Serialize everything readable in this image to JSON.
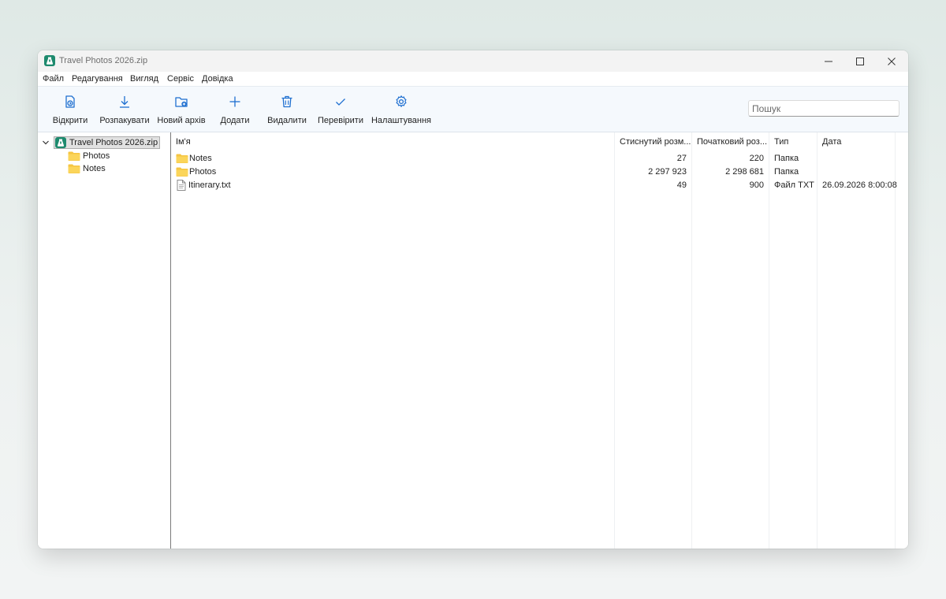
{
  "window": {
    "title": "Travel Photos 2026.zip"
  },
  "menu": [
    "Файл",
    "Редагування",
    "Вигляд",
    "Сервіс",
    "Довідка"
  ],
  "toolbar": {
    "items": [
      {
        "label": "Відкрити",
        "icon": "open-icon"
      },
      {
        "label": "Розпакувати",
        "icon": "download-icon"
      },
      {
        "label": "Новий архів",
        "icon": "new-folder-icon"
      },
      {
        "label": "Додати",
        "icon": "plus-icon"
      },
      {
        "label": "Видалити",
        "icon": "trash-icon"
      },
      {
        "label": "Перевірити",
        "icon": "check-icon"
      },
      {
        "label": "Налаштування",
        "icon": "gear-icon"
      }
    ],
    "search_placeholder": "Пошук"
  },
  "tree": {
    "root": "Travel Photos 2026.zip",
    "children": [
      "Photos",
      "Notes"
    ]
  },
  "list": {
    "columns": [
      "Ім'я",
      "Стиснутий розм...",
      "Початковий роз...",
      "Тип",
      "Дата"
    ],
    "rows": [
      {
        "name": "Notes",
        "icon": "folder-icon",
        "packed": "27",
        "size": "220",
        "type": "Папка",
        "date": ""
      },
      {
        "name": "Photos",
        "icon": "folder-icon",
        "packed": "2 297 923",
        "size": "2 298 681",
        "type": "Папка",
        "date": ""
      },
      {
        "name": "Itinerary.txt",
        "icon": "text-file-icon",
        "packed": "49",
        "size": "900",
        "type": "Файл TXT",
        "date": "26.09.2026 8:00:08"
      }
    ]
  },
  "colors": {
    "accent": "#1e6fd0",
    "app_icon": "#1e8a6e",
    "folder": "#f5c542",
    "toolbar_bg": "#f5f9fd"
  }
}
